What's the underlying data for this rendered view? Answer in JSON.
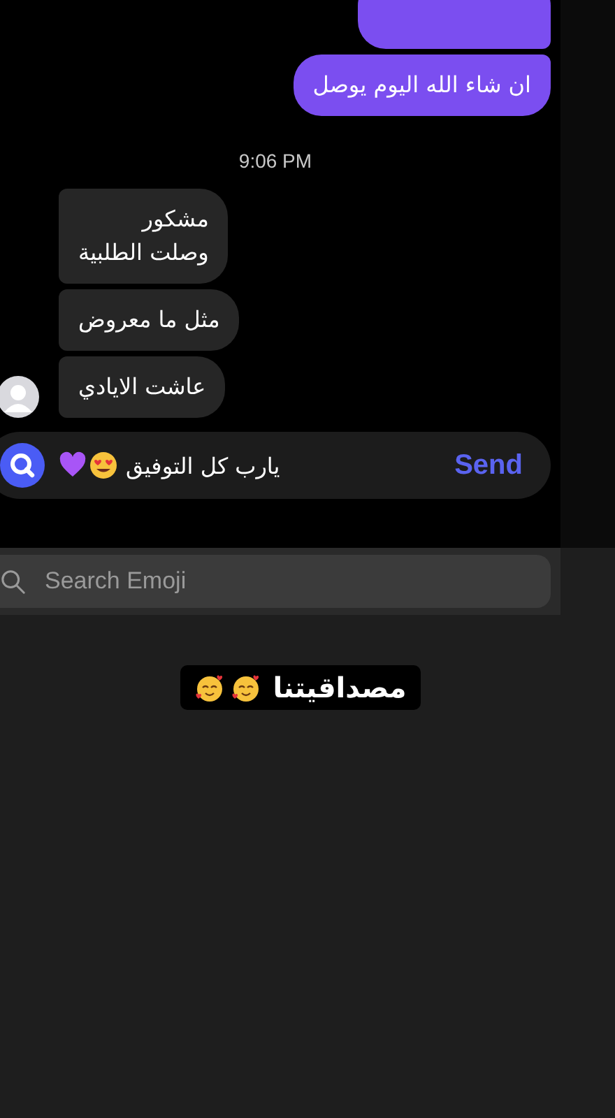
{
  "messages": [
    {
      "kind": "outgoing_cut"
    },
    {
      "kind": "outgoing",
      "lines": [
        "ان شاء الله اليوم يوصل"
      ]
    },
    {
      "kind": "time",
      "text": "9:06 PM"
    },
    {
      "kind": "incoming",
      "lines": [
        "مشكور",
        "وصلت الطلبية"
      ],
      "avatar": false
    },
    {
      "kind": "incoming",
      "lines": [
        "مثل ما معروض"
      ],
      "avatar": false
    },
    {
      "kind": "incoming",
      "lines": [
        "عاشت الايادي"
      ],
      "avatar": true
    }
  ],
  "composer": {
    "value": "يارب كل التوفيق",
    "send": "Send"
  },
  "emoji_search": {
    "placeholder": "Search Emoji"
  },
  "caption": {
    "text": "مصداقيتنا"
  }
}
